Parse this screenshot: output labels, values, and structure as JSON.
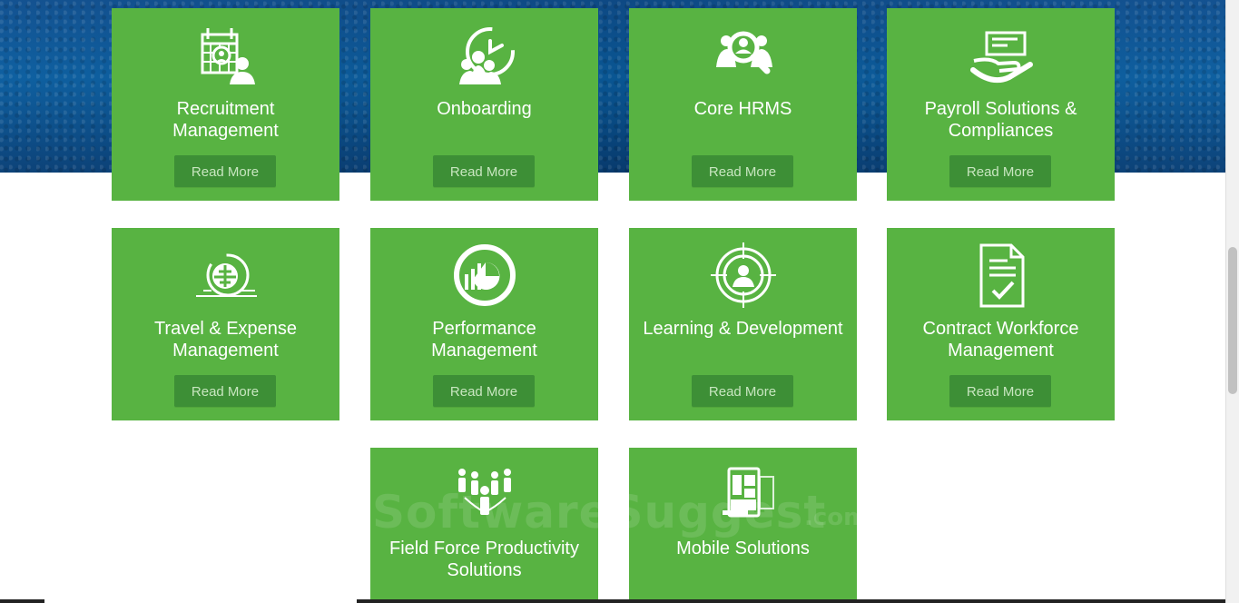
{
  "watermark": {
    "main": "SoftwareSuggest",
    "suffix": ".com"
  },
  "cards": [
    {
      "title_line1": "Recruitment",
      "title_line2": "Management",
      "button": "Read More",
      "icon": "calendar-person-icon"
    },
    {
      "title_line1": "Onboarding",
      "title_line2": "",
      "button": "Read More",
      "icon": "clock-team-icon"
    },
    {
      "title_line1": "Core HRMS",
      "title_line2": "",
      "button": "Read More",
      "icon": "magnifier-team-icon"
    },
    {
      "title_line1": "Payroll Solutions &",
      "title_line2": "Compliances",
      "button": "Read More",
      "icon": "check-hand-icon"
    },
    {
      "title_line1": "Travel & Expense",
      "title_line2": "Management",
      "button": "Read More",
      "icon": "airplane-globe-icon"
    },
    {
      "title_line1": "Performance",
      "title_line2": "Management",
      "button": "Read More",
      "icon": "performance-chart-icon"
    },
    {
      "title_line1": "Learning & Development",
      "title_line2": "",
      "button": "Read More",
      "icon": "target-person-icon"
    },
    {
      "title_line1": "Contract Workforce",
      "title_line2": "Management",
      "button": "Read More",
      "icon": "contract-check-icon"
    },
    {
      "title_line1": "Field Force Productivity",
      "title_line2": "Solutions",
      "button": "",
      "icon": "field-force-team-icon"
    },
    {
      "title_line1": "Mobile Solutions",
      "title_line2": "",
      "button": "",
      "icon": "mobile-devices-icon"
    }
  ]
}
